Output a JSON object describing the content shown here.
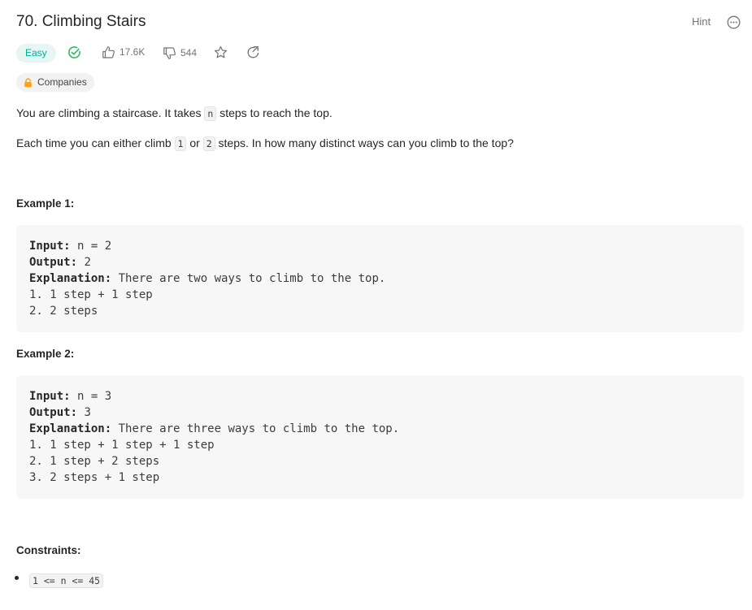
{
  "problem": {
    "title": "70. Climbing Stairs",
    "hint_label": "Hint",
    "difficulty": "Easy",
    "likes": "17.6K",
    "dislikes": "544",
    "companies_label": "Companies"
  },
  "description": {
    "p1_before": "You are climbing a staircase. It takes ",
    "p1_code": "n",
    "p1_after": " steps to reach the top.",
    "p2_before": "Each time you can either climb ",
    "p2_code1": "1",
    "p2_mid": " or ",
    "p2_code2": "2",
    "p2_after": " steps. In how many distinct ways can you climb to the top?"
  },
  "examples": [
    {
      "heading": "Example 1:",
      "input_label": "Input:",
      "input_value": " n = 2",
      "output_label": "Output:",
      "output_value": " 2",
      "explanation_label": "Explanation:",
      "explanation_value": " There are two ways to climb to the top.",
      "steps": [
        "1. 1 step + 1 step",
        "2. 2 steps"
      ]
    },
    {
      "heading": "Example 2:",
      "input_label": "Input:",
      "input_value": " n = 3",
      "output_label": "Output:",
      "output_value": " 3",
      "explanation_label": "Explanation:",
      "explanation_value": " There are three ways to climb to the top.",
      "steps": [
        "1. 1 step + 1 step + 1 step",
        "2. 1 step + 2 steps",
        "3. 2 steps + 1 step"
      ]
    }
  ],
  "constraints": {
    "heading": "Constraints:",
    "items": [
      "1 <= n <= 45"
    ]
  },
  "colors": {
    "easy_text": "#00af9b",
    "easy_bg": "#e7f6f4",
    "solved_check": "#2cbb5d",
    "lock": "#ffa116"
  }
}
